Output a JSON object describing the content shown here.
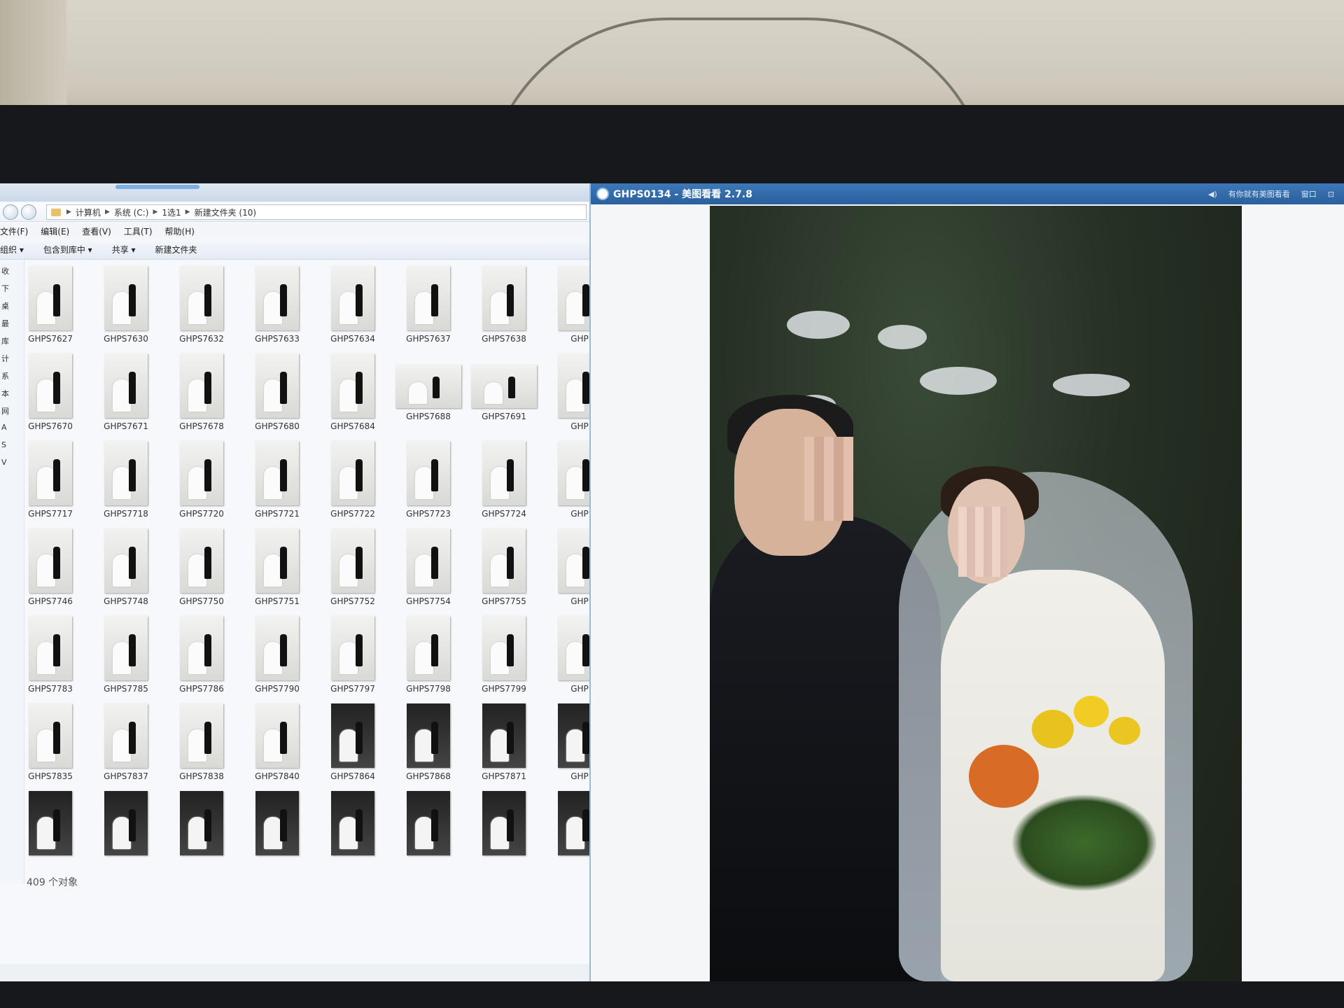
{
  "explorer": {
    "breadcrumb": [
      "计算机",
      "系统 (C:)",
      "1选1",
      "新建文件夹 (10)"
    ],
    "menu": [
      "文件(F)",
      "编辑(E)",
      "查看(V)",
      "工具(T)",
      "帮助(H)"
    ],
    "toolbar": [
      "组织 ▾",
      "包含到库中 ▾",
      "共享 ▾",
      "新建文件夹"
    ],
    "nav_items": [
      "收",
      "下",
      "桌",
      "最",
      "库",
      "计",
      "系",
      "本",
      "网",
      "A",
      "S",
      "V"
    ],
    "files": [
      "GHPS7627",
      "GHPS7630",
      "GHPS7632",
      "GHPS7633",
      "GHPS7634",
      "GHPS7637",
      "GHPS7638",
      "GHP",
      "GHPS7670",
      "GHPS7671",
      "GHPS7678",
      "GHPS7680",
      "GHPS7684",
      "GHPS7688",
      "GHPS7691",
      "GHP",
      "GHPS7717",
      "GHPS7718",
      "GHPS7720",
      "GHPS7721",
      "GHPS7722",
      "GHPS7723",
      "GHPS7724",
      "GHP",
      "GHPS7746",
      "GHPS7748",
      "GHPS7750",
      "GHPS7751",
      "GHPS7752",
      "GHPS7754",
      "GHPS7755",
      "GHP",
      "GHPS7783",
      "GHPS7785",
      "GHPS7786",
      "GHPS7790",
      "GHPS7797",
      "GHPS7798",
      "GHPS7799",
      "GHP",
      "GHPS7835",
      "GHPS7837",
      "GHPS7838",
      "GHPS7840",
      "GHPS7864",
      "GHPS7868",
      "GHPS7871",
      "GHP",
      "",
      "",
      "",
      "",
      "",
      "",
      "",
      ""
    ],
    "status": "409 个对象"
  },
  "viewer": {
    "title": "GHPS0134 - 美图看看 2.7.8",
    "right_text": [
      "◀)",
      "有你就有美图看看",
      "窗口",
      "⊡"
    ]
  }
}
